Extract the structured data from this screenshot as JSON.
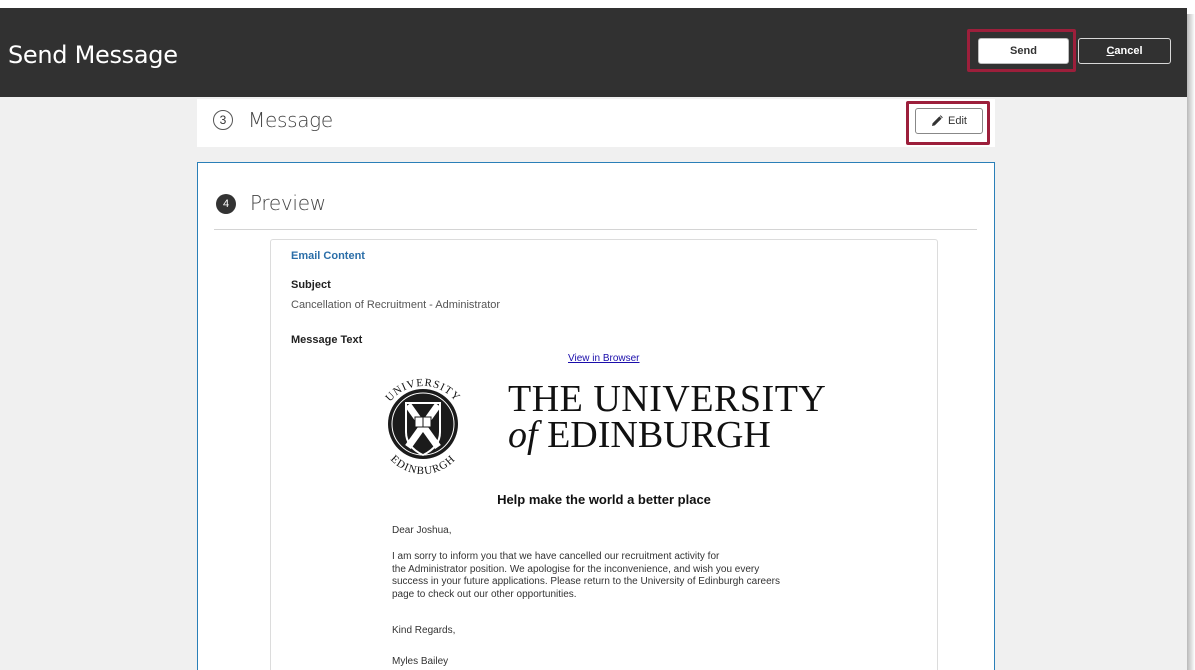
{
  "header": {
    "title": "Send Message",
    "send_label": "Send",
    "cancel_label_first": "C",
    "cancel_label_rest": "ancel"
  },
  "step3": {
    "number": "3",
    "title": "Message",
    "edit_label": "Edit"
  },
  "step4": {
    "number": "4",
    "title": "Preview"
  },
  "email": {
    "heading": "Email Content",
    "subject_label": "Subject",
    "subject_value": "Cancellation of Recruitment - Administrator",
    "message_label": "Message Text",
    "view_in_browser": "View in Browser",
    "logo_line1": "THE UNIVERSITY",
    "logo_of": "of",
    "logo_line2": "EDINBURGH",
    "crest_text_top": "UNIVERSITY",
    "crest_text_bottom": "EDINBURGH",
    "tagline": "Help make the world a better place",
    "greeting": "Dear Joshua,",
    "body_lines": [
      "I am sorry to inform you that we have cancelled our recruitment activity for",
      "the Administrator position. We apologise for the inconvenience, and wish you every",
      "success in your future applications. Please return to the University of Edinburgh careers",
      "page to check out our other opportunities."
    ],
    "closing": "Kind Regards,",
    "signature": "Myles Bailey"
  },
  "colors": {
    "header_bg": "#313131",
    "highlight": "#9c1f3b",
    "accent_blue": "#2a7fb8",
    "link": "#1a0dab"
  }
}
